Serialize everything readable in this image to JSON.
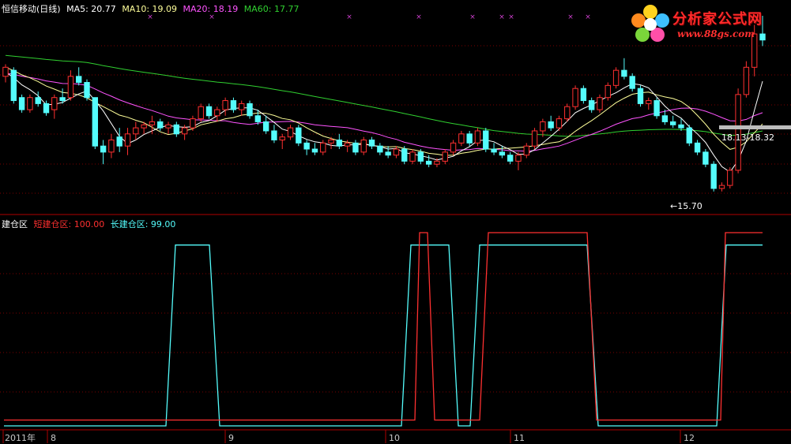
{
  "header_main": {
    "title": "恒信移动(日线)",
    "ma5": "MA5: 20.77",
    "ma10": "MA10: 19.09",
    "ma20": "MA20: 18.19",
    "ma60": "MA60: 17.77"
  },
  "header_sub": {
    "name": "建仓区",
    "short": "短建仓区: 100.00",
    "long": "长建仓区: 99.00"
  },
  "annotations": {
    "low": "←15.70",
    "range": "18.13-18.32"
  },
  "watermark": {
    "line1": "分析家公式网",
    "line2": "www.88gs.com"
  },
  "colors": {
    "background": "#000000",
    "up_candle": "#ff3030",
    "down_candle": "#54fcfc",
    "ma5": "#ffffff",
    "ma10": "#ffff9a",
    "ma20": "#ff54ff",
    "ma60": "#30d030",
    "short_line": "#ff3030",
    "long_line": "#54fcfc",
    "grid": "#7a0000"
  },
  "chart_data": [
    {
      "type": "candlestick",
      "title": "恒信移动(日线)",
      "ylim": [
        15.2,
        21.5
      ],
      "legend": [
        "MA5: 20.77",
        "MA10: 19.09",
        "MA20: 18.19",
        "MA60: 17.77"
      ],
      "min_label": "←15.70",
      "range_label": "18.13-18.32",
      "ohlc": [
        [
          19.5,
          19.9,
          19.3,
          19.8
        ],
        [
          19.7,
          19.8,
          18.6,
          18.7
        ],
        [
          18.8,
          18.9,
          18.3,
          18.4
        ],
        [
          18.4,
          18.9,
          18.3,
          18.8
        ],
        [
          18.8,
          19.0,
          18.5,
          18.6
        ],
        [
          18.6,
          18.7,
          18.2,
          18.3
        ],
        [
          18.4,
          18.9,
          18.1,
          18.8
        ],
        [
          18.8,
          19.1,
          18.6,
          18.7
        ],
        [
          18.8,
          19.7,
          18.7,
          19.5
        ],
        [
          19.5,
          19.8,
          19.2,
          19.3
        ],
        [
          19.3,
          19.4,
          18.7,
          18.8
        ],
        [
          18.8,
          18.8,
          17.1,
          17.2
        ],
        [
          17.2,
          17.4,
          16.6,
          17.0
        ],
        [
          17.0,
          17.6,
          16.8,
          17.4
        ],
        [
          17.5,
          17.8,
          17.0,
          17.2
        ],
        [
          17.2,
          17.8,
          16.9,
          17.6
        ],
        [
          17.6,
          18.0,
          17.4,
          17.8
        ],
        [
          17.8,
          18.0,
          17.6,
          17.9
        ],
        [
          17.9,
          18.2,
          17.6,
          18.0
        ],
        [
          18.0,
          18.1,
          17.7,
          17.8
        ],
        [
          17.8,
          18.0,
          17.6,
          17.9
        ],
        [
          17.9,
          18.0,
          17.5,
          17.6
        ],
        [
          17.6,
          17.9,
          17.4,
          17.8
        ],
        [
          17.8,
          18.2,
          17.7,
          18.1
        ],
        [
          18.1,
          18.6,
          18.0,
          18.5
        ],
        [
          18.5,
          18.6,
          18.1,
          18.2
        ],
        [
          18.2,
          18.5,
          18.0,
          18.4
        ],
        [
          18.4,
          18.8,
          18.2,
          18.7
        ],
        [
          18.7,
          18.8,
          18.3,
          18.4
        ],
        [
          18.4,
          18.7,
          18.2,
          18.6
        ],
        [
          18.6,
          18.7,
          18.1,
          18.2
        ],
        [
          18.2,
          18.4,
          17.9,
          18.0
        ],
        [
          18.0,
          18.2,
          17.6,
          17.7
        ],
        [
          17.7,
          17.9,
          17.3,
          17.4
        ],
        [
          17.4,
          17.6,
          17.1,
          17.5
        ],
        [
          17.5,
          17.9,
          17.4,
          17.8
        ],
        [
          17.8,
          17.9,
          17.2,
          17.3
        ],
        [
          17.3,
          17.4,
          16.9,
          17.1
        ],
        [
          17.1,
          17.3,
          16.9,
          17.0
        ],
        [
          17.0,
          17.4,
          16.9,
          17.3
        ],
        [
          17.3,
          17.5,
          17.1,
          17.4
        ],
        [
          17.4,
          17.6,
          17.1,
          17.2
        ],
        [
          17.2,
          17.4,
          17.0,
          17.3
        ],
        [
          17.3,
          17.4,
          16.9,
          17.0
        ],
        [
          17.0,
          17.5,
          16.9,
          17.4
        ],
        [
          17.4,
          17.5,
          17.1,
          17.2
        ],
        [
          17.2,
          17.3,
          16.9,
          17.0
        ],
        [
          17.0,
          17.2,
          16.8,
          16.9
        ],
        [
          16.9,
          17.2,
          16.8,
          17.1
        ],
        [
          17.1,
          17.2,
          16.6,
          16.7
        ],
        [
          16.7,
          17.1,
          16.6,
          17.0
        ],
        [
          17.0,
          17.1,
          16.6,
          16.7
        ],
        [
          16.7,
          16.9,
          16.5,
          16.6
        ],
        [
          16.6,
          16.8,
          16.5,
          16.7
        ],
        [
          16.7,
          17.1,
          16.6,
          17.0
        ],
        [
          17.0,
          17.4,
          16.9,
          17.3
        ],
        [
          17.3,
          17.7,
          17.2,
          17.6
        ],
        [
          17.6,
          17.7,
          17.2,
          17.3
        ],
        [
          17.3,
          17.8,
          17.2,
          17.7
        ],
        [
          17.7,
          17.8,
          17.0,
          17.1
        ],
        [
          17.1,
          17.3,
          16.9,
          17.0
        ],
        [
          17.0,
          17.2,
          16.8,
          16.9
        ],
        [
          16.9,
          17.0,
          16.6,
          16.7
        ],
        [
          16.7,
          17.0,
          16.4,
          16.9
        ],
        [
          16.9,
          17.3,
          16.8,
          17.2
        ],
        [
          17.2,
          17.8,
          17.1,
          17.7
        ],
        [
          17.7,
          18.1,
          17.5,
          18.0
        ],
        [
          18.0,
          18.2,
          17.7,
          17.8
        ],
        [
          17.8,
          18.2,
          17.7,
          18.1
        ],
        [
          18.1,
          18.6,
          18.0,
          18.5
        ],
        [
          18.5,
          19.2,
          18.4,
          19.1
        ],
        [
          19.1,
          19.2,
          18.6,
          18.7
        ],
        [
          18.7,
          18.8,
          18.3,
          18.4
        ],
        [
          18.4,
          18.9,
          18.3,
          18.8
        ],
        [
          18.8,
          19.3,
          18.7,
          19.2
        ],
        [
          19.2,
          19.8,
          19.1,
          19.7
        ],
        [
          19.7,
          20.1,
          19.4,
          19.5
        ],
        [
          19.5,
          19.6,
          19.0,
          19.1
        ],
        [
          19.1,
          19.2,
          18.5,
          18.6
        ],
        [
          18.6,
          18.8,
          18.4,
          18.7
        ],
        [
          18.7,
          18.8,
          18.1,
          18.2
        ],
        [
          18.2,
          18.4,
          17.9,
          18.0
        ],
        [
          18.0,
          18.2,
          17.8,
          17.9
        ],
        [
          17.9,
          18.1,
          17.7,
          17.8
        ],
        [
          17.8,
          17.9,
          17.2,
          17.3
        ],
        [
          17.3,
          17.4,
          16.9,
          17.0
        ],
        [
          17.0,
          17.1,
          16.5,
          16.6
        ],
        [
          16.6,
          16.7,
          15.7,
          15.8
        ],
        [
          15.8,
          16.0,
          15.7,
          15.9
        ],
        [
          15.9,
          16.5,
          15.8,
          16.4
        ],
        [
          16.4,
          19.1,
          16.3,
          18.9
        ],
        [
          18.9,
          20.0,
          18.8,
          19.8
        ],
        [
          19.8,
          21.2,
          19.5,
          20.9
        ],
        [
          20.9,
          21.5,
          20.5,
          20.7
        ]
      ]
    },
    {
      "type": "line",
      "title": "建仓区",
      "series": [
        {
          "name": "短建仓区: 100.00",
          "color": "#ff3030"
        },
        {
          "name": "长建仓区: 99.00",
          "color": "#54fcfc"
        }
      ],
      "ylim": [
        0,
        100
      ],
      "x_labels": [
        "2011年",
        "8",
        "9",
        "10",
        "11",
        "12"
      ]
    }
  ]
}
